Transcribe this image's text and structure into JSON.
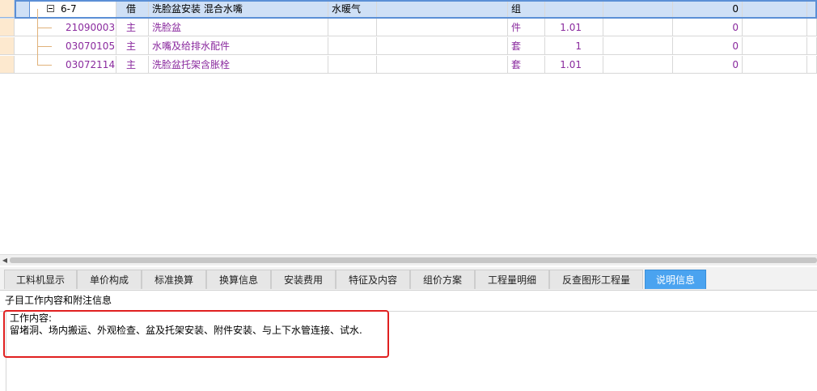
{
  "rows": [
    {
      "code": "6-7",
      "type": "借",
      "name": "洗脸盆安装 混合水嘴",
      "spec": "水暖气",
      "extra": "",
      "unit": "组",
      "qty": "",
      "price": "",
      "total": "0"
    },
    {
      "code": "21090003",
      "type": "主",
      "name": "洗脸盆",
      "spec": "",
      "extra": "",
      "unit": "件",
      "qty": "1.01",
      "price": "",
      "total": "0"
    },
    {
      "code": "03070105",
      "type": "主",
      "name": "水嘴及给排水配件",
      "spec": "",
      "extra": "",
      "unit": "套",
      "qty": "1",
      "price": "",
      "total": "0"
    },
    {
      "code": "03072114",
      "type": "主",
      "name": "洗脸盆托架含胀栓",
      "spec": "",
      "extra": "",
      "unit": "套",
      "qty": "1.01",
      "price": "",
      "total": "0"
    }
  ],
  "tabs": [
    {
      "label": "工料机显示"
    },
    {
      "label": "单价构成"
    },
    {
      "label": "标准换算"
    },
    {
      "label": "换算信息"
    },
    {
      "label": "安装费用"
    },
    {
      "label": "特征及内容"
    },
    {
      "label": "组价方案"
    },
    {
      "label": "工程量明细"
    },
    {
      "label": "反查图形工程量"
    },
    {
      "label": "说明信息",
      "active": true
    }
  ],
  "panel": {
    "title": "子目工作内容和附注信息",
    "content_heading": "工作内容:",
    "content_body": "留堵洞、场内搬运、外观检查、盆及托架安装、附件安装、与上下水管连接、试水."
  },
  "colors": {
    "accent": "#4aa3f0",
    "material": "#8a2a9e",
    "highlight": "#e02020",
    "selected_row": "#cfe0f6"
  },
  "icons": {
    "collapse": "minus-box-icon",
    "scroll_left": "left-arrow-icon"
  }
}
